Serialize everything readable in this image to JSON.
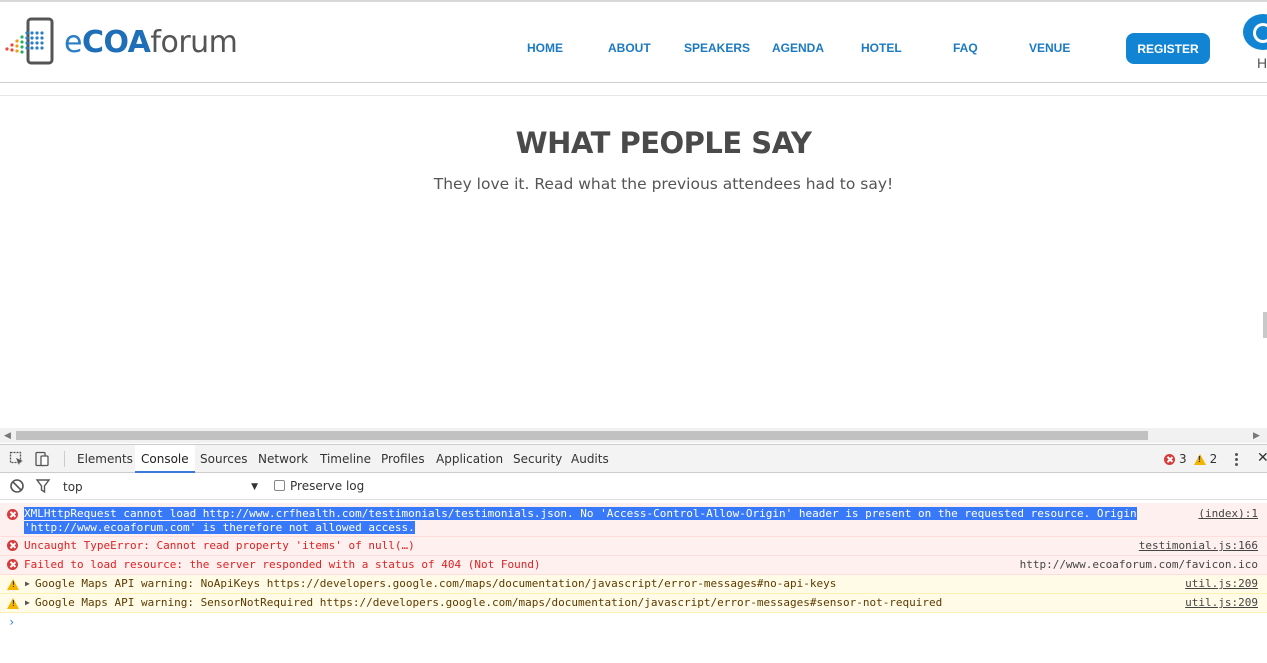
{
  "header": {
    "logo": {
      "e": "e",
      "coa": "COA",
      "forum": "forum"
    },
    "nav": [
      "HOME",
      "ABOUT",
      "SPEAKERS",
      "AGENDA",
      "HOTEL",
      "FAQ",
      "VENUE"
    ],
    "register_label": "REGISTER",
    "corner_letter": "H"
  },
  "section": {
    "title": "WHAT PEOPLE SAY",
    "subtitle": "They love it. Read what the previous attendees had to say!"
  },
  "devtools": {
    "tabs": [
      "Elements",
      "Console",
      "Sources",
      "Network",
      "Timeline",
      "Profiles",
      "Application",
      "Security",
      "Audits"
    ],
    "active_tab": "Console",
    "error_count": "3",
    "warning_count": "2",
    "context": "top",
    "preserve_log_label": "Preserve log",
    "messages": [
      {
        "level": "error",
        "text1": "XMLHttpRequest cannot load http://www.crfhealth.com/testimonials/testimonials.json. No 'Access-Control-Allow-Origin' header is present on the requested resource. Origin",
        "text2": "'http://www.ecoaforum.com' is therefore not allowed access.",
        "source": "(index):1"
      },
      {
        "level": "error",
        "text": "Uncaught TypeError: Cannot read property 'items' of null(…)",
        "source": "testimonial.js:166"
      },
      {
        "level": "error",
        "text": "Failed to load resource: the server responded with a status of 404 (Not Found)",
        "source": "http://www.ecoaforum.com/favicon.ico"
      },
      {
        "level": "warning",
        "text": "Google Maps API warning: NoApiKeys https://developers.google.com/maps/documentation/javascript/error-messages#no-api-keys",
        "source": "util.js:209"
      },
      {
        "level": "warning",
        "text": "Google Maps API warning: SensorNotRequired https://developers.google.com/maps/documentation/javascript/error-messages#sensor-not-required",
        "source": "util.js:209"
      }
    ],
    "prompt": "›"
  },
  "colors": {
    "brand_blue": "#1284d4",
    "nav_blue": "#1b7ac2",
    "error_red": "#d83b3b",
    "warning_yellow": "#f4b400",
    "selection_blue": "#3879f9"
  }
}
